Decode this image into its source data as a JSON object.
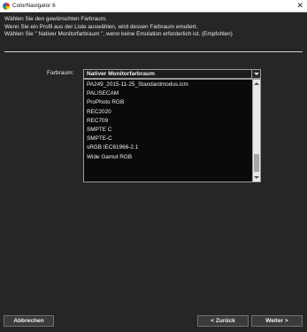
{
  "window": {
    "title": "ColorNavigator 6",
    "close_glyph": "✕"
  },
  "instructions": [
    "Wählen Sie den gewünschten Farbraum.",
    "Wenn Sie ein Profil aus der Liste auswählen, wird dessen Farbraum emuliert.",
    "Wählen Sie \" Nativer Monitorfarbraum \", wenn keine Emulation erforderlich ist. (Empfohlen)"
  ],
  "colorspace": {
    "label": "Farbraum:",
    "selected": "Nativer Monitorfarbraum",
    "options": [
      "PA249_2015-11-25_Standardmodus.icm",
      "PAL/SECAM",
      "ProPhoto RGB",
      "REC2020",
      "REC709",
      "SMPTE C",
      "SMPTE-C",
      "sRGB IEC61966-2.1",
      "Wide Gamut RGB"
    ]
  },
  "buttons": {
    "cancel": "Abbrechen",
    "back": "< Zurück",
    "next": "Weiter >"
  },
  "colors": {
    "background": "#262626",
    "titlebar": "#ffffff",
    "list_background": "#0a0a0a",
    "button": "#3b3b3b"
  }
}
